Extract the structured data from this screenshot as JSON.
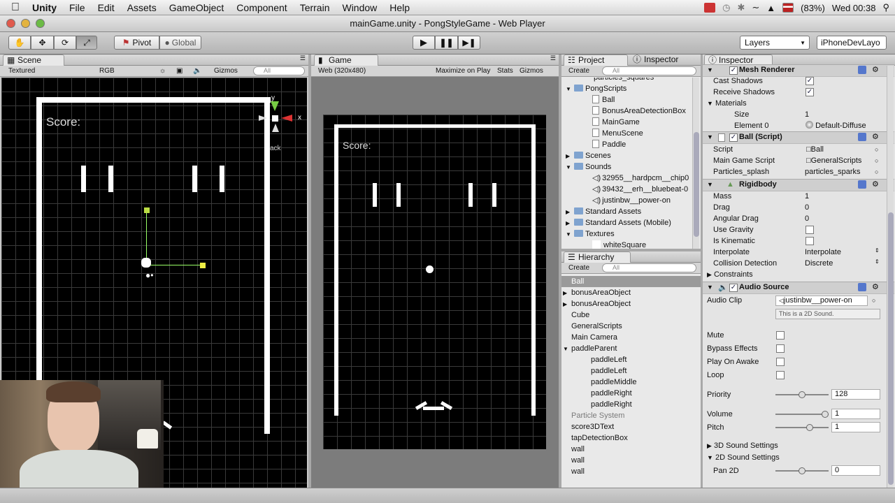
{
  "menubar": {
    "app": "Unity",
    "items": [
      "File",
      "Edit",
      "Assets",
      "GameObject",
      "Component",
      "Terrain",
      "Window",
      "Help"
    ],
    "battery": "(83%)",
    "clock": "Wed 00:38"
  },
  "window": {
    "title": "mainGame.unity - PongStyleGame - Web Player"
  },
  "toolbar": {
    "pivot": "Pivot",
    "global": "Global",
    "layers": "Layers",
    "layout": "iPhoneDevLayo"
  },
  "scene": {
    "tab": "Scene",
    "shading": "Textured",
    "render": "RGB",
    "gizmos": "Gizmos",
    "search": "All",
    "score": "Score:",
    "axis_x": "x",
    "axis_y": "y",
    "back": "ack"
  },
  "game": {
    "tab": "Game",
    "aspect": "Web (320x480)",
    "maximize": "Maximize on Play",
    "stats": "Stats",
    "gizmos": "Gizmos",
    "score": "Score:"
  },
  "project": {
    "tab": "Project",
    "tab2": "Inspector",
    "create": "Create",
    "search": "All",
    "items": [
      {
        "label": "particles_squares",
        "depth": 2,
        "type": "file"
      },
      {
        "label": "PongScripts",
        "depth": 0,
        "type": "folder-open"
      },
      {
        "label": "Ball",
        "depth": 1,
        "type": "script"
      },
      {
        "label": "BonusAreaDetectionBox",
        "depth": 1,
        "type": "script"
      },
      {
        "label": "MainGame",
        "depth": 1,
        "type": "script"
      },
      {
        "label": "MenuScene",
        "depth": 1,
        "type": "script"
      },
      {
        "label": "Paddle",
        "depth": 1,
        "type": "script"
      },
      {
        "label": "Scenes",
        "depth": 0,
        "type": "folder"
      },
      {
        "label": "Sounds",
        "depth": 0,
        "type": "folder-open"
      },
      {
        "label": "32955__hardpcm__chip0",
        "depth": 1,
        "type": "audio"
      },
      {
        "label": "39432__erh__bluebeat-0",
        "depth": 1,
        "type": "audio"
      },
      {
        "label": "justinbw__power-on",
        "depth": 1,
        "type": "audio"
      },
      {
        "label": "Standard Assets",
        "depth": 0,
        "type": "folder"
      },
      {
        "label": "Standard Assets (Mobile)",
        "depth": 0,
        "type": "folder"
      },
      {
        "label": "Textures",
        "depth": 0,
        "type": "folder-open"
      },
      {
        "label": "whiteSquare",
        "depth": 1,
        "type": "texture"
      }
    ]
  },
  "hierarchy": {
    "tab": "Hierarchy",
    "create": "Create",
    "search": "All",
    "items": [
      {
        "label": "Ball",
        "depth": 0,
        "selected": true
      },
      {
        "label": "bonusAreaObject",
        "depth": 0,
        "arrow": true
      },
      {
        "label": "bonusAreaObject",
        "depth": 0,
        "arrow": true
      },
      {
        "label": "Cube",
        "depth": 0
      },
      {
        "label": "GeneralScripts",
        "depth": 0
      },
      {
        "label": "Main Camera",
        "depth": 0
      },
      {
        "label": "paddleParent",
        "depth": 0,
        "open": true
      },
      {
        "label": "paddleLeft",
        "depth": 1
      },
      {
        "label": "paddleLeft",
        "depth": 1
      },
      {
        "label": "paddleMiddle",
        "depth": 1
      },
      {
        "label": "paddleRight",
        "depth": 1
      },
      {
        "label": "paddleRight",
        "depth": 1
      },
      {
        "label": "Particle System",
        "depth": 0,
        "dim": true
      },
      {
        "label": "score3DText",
        "depth": 0
      },
      {
        "label": "tapDetectionBox",
        "depth": 0
      },
      {
        "label": "wall",
        "depth": 0
      },
      {
        "label": "wall",
        "depth": 0
      },
      {
        "label": "wall",
        "depth": 0
      }
    ]
  },
  "inspector": {
    "tab": "Inspector",
    "mesh_renderer": {
      "title": "Mesh Renderer",
      "cast_shadows": "Cast Shadows",
      "receive_shadows": "Receive Shadows",
      "materials": "Materials",
      "size": "Size",
      "size_val": "1",
      "element0": "Element 0",
      "element0_val": "Default-Diffuse"
    },
    "ball_script": {
      "title": "Ball (Script)",
      "script": "Script",
      "script_val": "Ball",
      "main_game": "Main Game Script",
      "main_game_val": "GeneralScripts",
      "splash": "Particles_splash",
      "splash_val": "particles_sparks"
    },
    "rigidbody": {
      "title": "Rigidbody",
      "mass": "Mass",
      "mass_val": "1",
      "drag": "Drag",
      "drag_val": "0",
      "angular_drag": "Angular Drag",
      "angular_drag_val": "0",
      "use_gravity": "Use Gravity",
      "is_kinematic": "Is Kinematic",
      "interpolate": "Interpolate",
      "interpolate_val": "Interpolate",
      "collision": "Collision Detection",
      "collision_val": "Discrete",
      "constraints": "Constraints"
    },
    "audio": {
      "title": "Audio Source",
      "clip": "Audio Clip",
      "clip_val": "justinbw__power-on",
      "clip_note": "This is a 2D Sound.",
      "mute": "Mute",
      "bypass": "Bypass Effects",
      "play_on_awake": "Play On Awake",
      "loop": "Loop",
      "priority": "Priority",
      "priority_val": "128",
      "priority_level": 0.5,
      "volume": "Volume",
      "volume_val": "1",
      "volume_level": 1.0,
      "pitch": "Pitch",
      "pitch_val": "1",
      "pitch_level": 0.67,
      "s3d": "3D Sound Settings",
      "s2d": "2D Sound Settings",
      "pan": "Pan 2D",
      "pan_val": "0",
      "pan_level": 0.5
    }
  }
}
